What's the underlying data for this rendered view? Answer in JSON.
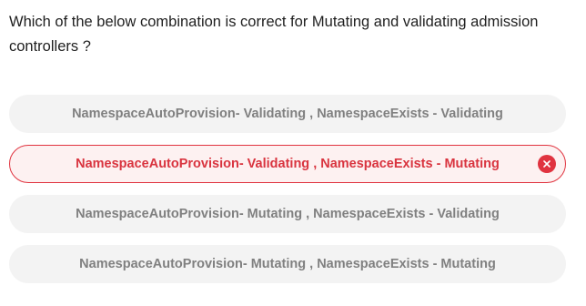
{
  "question": {
    "text": "Which of the below combination is correct for Mutating and validating admission controllers ?"
  },
  "options": [
    {
      "label": "NamespaceAutoProvision- Validating , NamespaceExists - Validating",
      "state": "default"
    },
    {
      "label": "NamespaceAutoProvision- Validating , NamespaceExists - Mutating",
      "state": "selected-wrong"
    },
    {
      "label": "NamespaceAutoProvision- Mutating , NamespaceExists - Validating",
      "state": "default"
    },
    {
      "label": "NamespaceAutoProvision- Mutating , NamespaceExists - Mutating",
      "state": "default"
    }
  ],
  "icons": {
    "wrong": "close-icon"
  },
  "colors": {
    "wrong_accent": "#e0333f",
    "wrong_background": "#fdf1f1",
    "option_background": "#f3f3f3",
    "option_text": "#808080"
  }
}
